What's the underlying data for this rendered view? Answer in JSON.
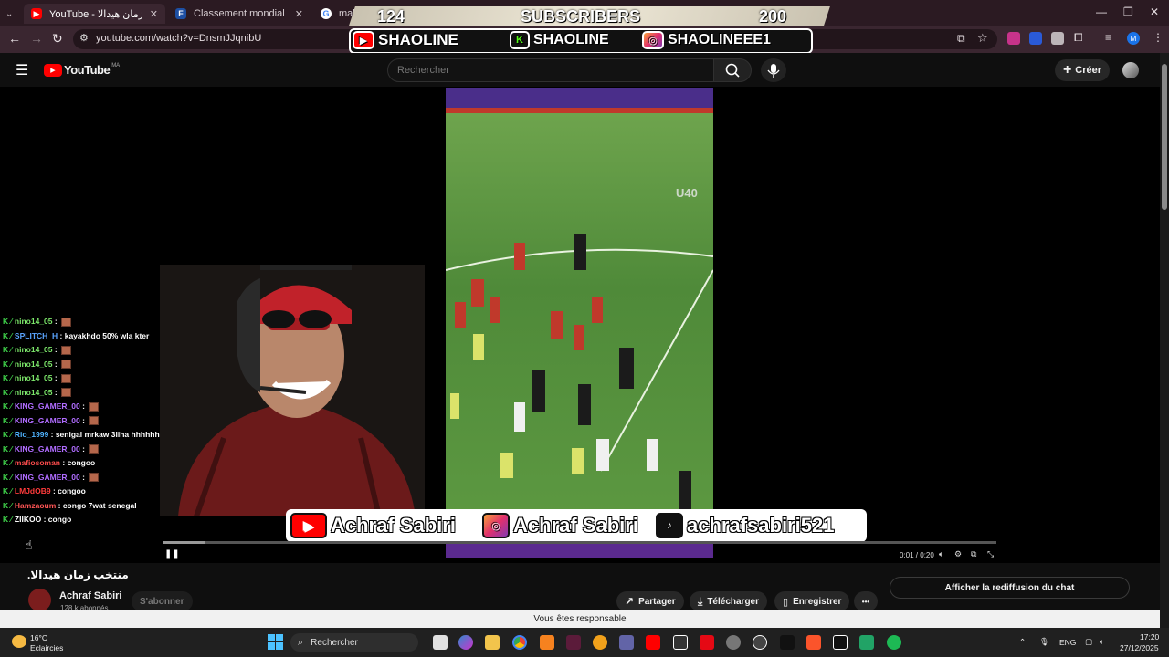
{
  "browser": {
    "tabs": [
      {
        "label": "YouTube - منتخب زمان هيدالا",
        "favicon": "youtube-icon",
        "active": true
      },
      {
        "label": "Classement mondial FIFA/Coca",
        "favicon": "fifa-icon",
        "active": false
      },
      {
        "label": "mali - R",
        "favicon": "google-icon",
        "active": false
      }
    ],
    "url": "youtube.com/watch?v=DnsmJJqnibU",
    "profile_initial": "M"
  },
  "overlay": {
    "subs_current": "124",
    "subs_label": "SUBSCRIBERS",
    "subs_goal": "200",
    "social_top": [
      {
        "platform": "youtube-icon",
        "handle": "SHAOLINE"
      },
      {
        "platform": "kick-icon",
        "handle": "SHAOLINE"
      },
      {
        "platform": "instagram-icon",
        "handle": "SHAOLINEEE1"
      }
    ],
    "social_bottom": [
      {
        "platform": "youtube-icon",
        "handle": "Achraf Sabiri"
      },
      {
        "platform": "instagram-icon",
        "handle": "Achraf Sabiri"
      },
      {
        "platform": "tiktok-icon",
        "handle": "achrafsabiri521"
      }
    ],
    "video_watermark": "U40"
  },
  "youtube": {
    "logo": "YouTube",
    "region": "MA",
    "search_placeholder": "Rechercher",
    "create_label": "Créer",
    "video_time": "0:01 / 0:20",
    "progress": 0.05,
    "title": "منتخب زمان هيدالا.",
    "channel_name": "Achraf Sabiri",
    "subscribers": "128 k abonnés",
    "subscribe_label": "S'abonner",
    "share_label": "Partager",
    "download_label": "Télécharger",
    "save_label": "Enregistrer",
    "more_label": "•••",
    "chat_replay_label": "Afficher la rediffusion du chat",
    "responsible_banner": "Vous êtes responsable"
  },
  "chat": [
    {
      "user": "nino14_05",
      "color": "#7de86b",
      "msg": "",
      "emoji": true
    },
    {
      "user": "SPLITCH_H",
      "color": "#5aa4ff",
      "msg": "kayakhdo 50% wla kter",
      "emoji": false
    },
    {
      "user": "nino14_05",
      "color": "#7de86b",
      "msg": "",
      "emoji": true
    },
    {
      "user": "nino14_05",
      "color": "#7de86b",
      "msg": "",
      "emoji": true
    },
    {
      "user": "nino14_05",
      "color": "#7de86b",
      "msg": "",
      "emoji": true
    },
    {
      "user": "nino14_05",
      "color": "#7de86b",
      "msg": "",
      "emoji": true
    },
    {
      "user": "KING_GAMER_00",
      "color": "#b06cff",
      "msg": "",
      "emoji": true
    },
    {
      "user": "KING_GAMER_00",
      "color": "#b06cff",
      "msg": "",
      "emoji": true
    },
    {
      "user": "Rio_1999",
      "color": "#4fb3ff",
      "msg": "senigal mrkaw 3liha hhhhhh",
      "emoji": false
    },
    {
      "user": "KING_GAMER_00",
      "color": "#b06cff",
      "msg": "",
      "emoji": true
    },
    {
      "user": "mafiosoman",
      "color": "#ff4d4d",
      "msg": "congoo",
      "emoji": false
    },
    {
      "user": "KING_GAMER_00",
      "color": "#b06cff",
      "msg": "",
      "emoji": true
    },
    {
      "user": "LMJdOB9",
      "color": "#ff3b3b",
      "msg": "congoo",
      "emoji": false
    },
    {
      "user": "Hamzaoum",
      "color": "#ff5555",
      "msg": "congo 7wat senegal",
      "emoji": false
    },
    {
      "user": "ZIIKOO",
      "color": "#ffffff",
      "msg": "congo",
      "emoji": false
    }
  ],
  "taskbar": {
    "weather_temp": "16°C",
    "weather_desc": "Eclaircies",
    "search_label": "Rechercher",
    "lang": "ENG",
    "time": "17:20",
    "date": "27/12/2025"
  }
}
